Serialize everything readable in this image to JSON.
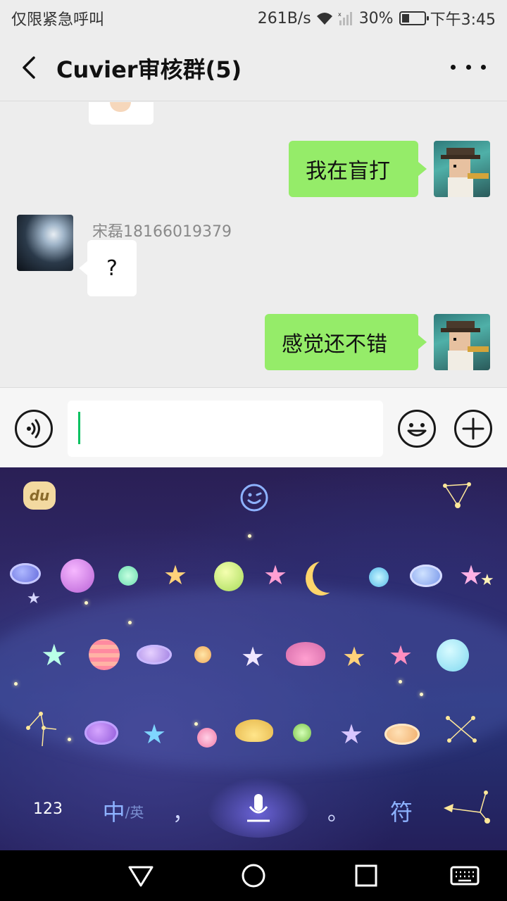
{
  "status_bar": {
    "carrier": "仅限紧急呼叫",
    "speed": "261B/s",
    "battery": "30%",
    "time": "下午3:45"
  },
  "header": {
    "title": "Cuvier审核群(5)"
  },
  "messages": [
    {
      "side": "right",
      "text": "我在盲打"
    },
    {
      "side": "left",
      "sender": "宋磊18166019379",
      "text": "?"
    },
    {
      "side": "right",
      "text": "感觉还不错"
    }
  ],
  "input": {
    "value": ""
  },
  "keyboard": {
    "numbers_key": "123",
    "lang_key_main": "中",
    "lang_key_sub": "/英",
    "comma_key": "，",
    "period_key": "。",
    "symbol_key": "符",
    "logo": "du"
  },
  "colors": {
    "sent_bubble": "#95ec69",
    "received_bubble": "#ffffff",
    "caret": "#07c160",
    "keyboard_label": "#8db2ff"
  }
}
